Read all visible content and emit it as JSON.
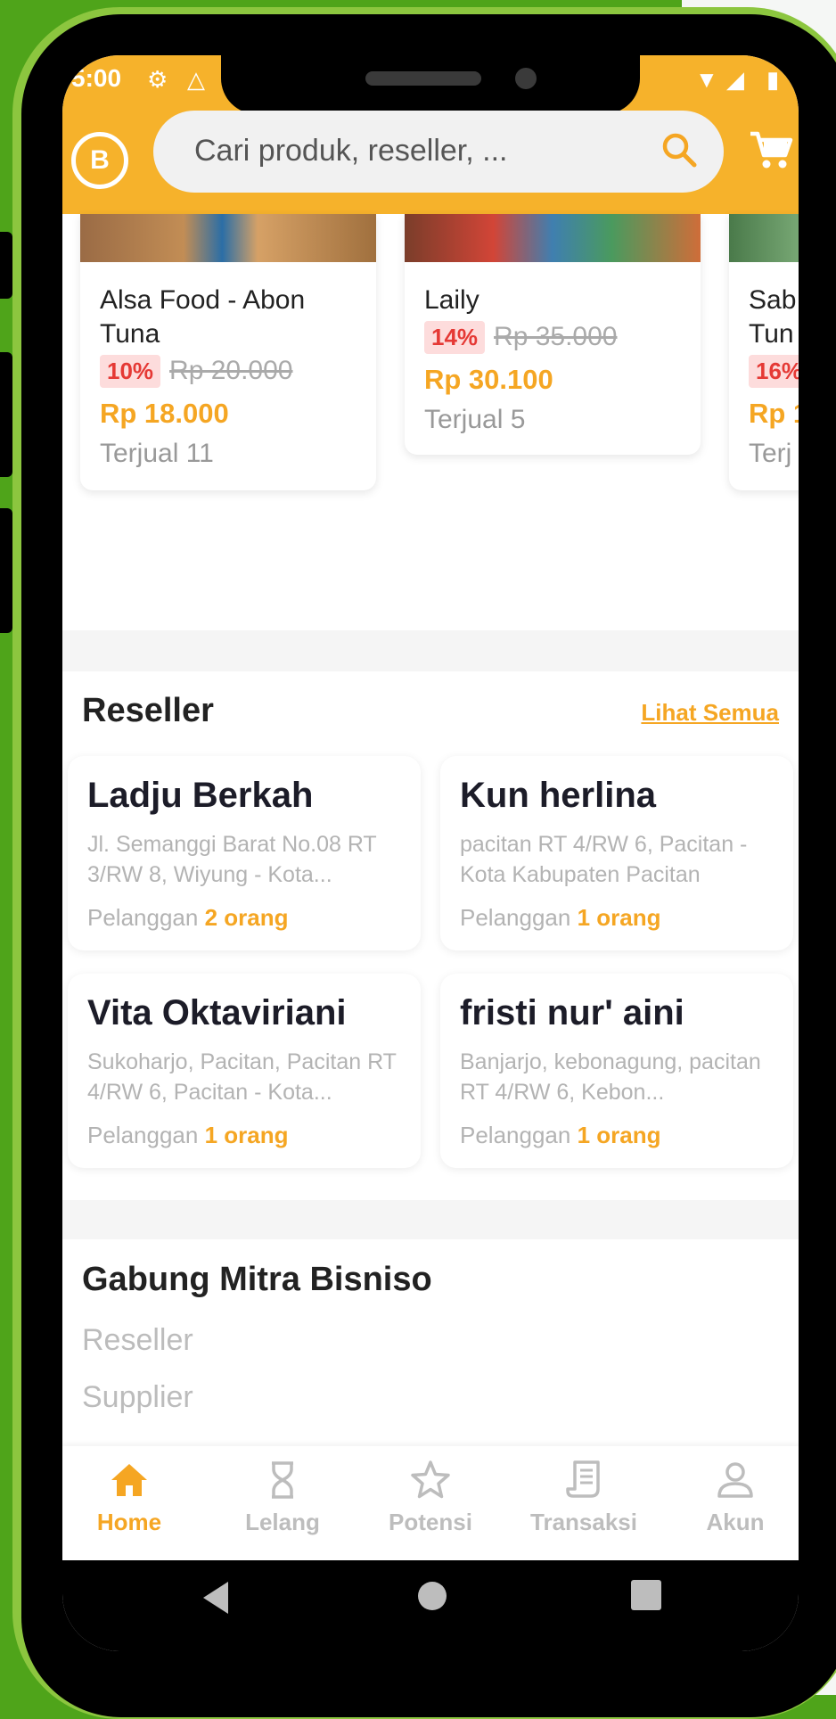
{
  "status": {
    "time": "5:00"
  },
  "header": {
    "logo_letter": "B"
  },
  "search": {
    "placeholder": "Cari produk, reseller, ..."
  },
  "products": [
    {
      "name": "Alsa Food - Abon Tuna",
      "discount": "10%",
      "old_price": "Rp 20.000",
      "price": "Rp 18.000",
      "sold": "Terjual 11"
    },
    {
      "name": "Laily",
      "discount": "14%",
      "old_price": "Rp 35.000",
      "price": "Rp 30.100",
      "sold": "Terjual 5"
    },
    {
      "name": "Sab Tun",
      "discount": "16%",
      "old_price": "",
      "price": "Rp 1",
      "sold": "Terj"
    }
  ],
  "reseller_section": {
    "title": "Reseller",
    "see_all": "Lihat Semua"
  },
  "resellers": [
    {
      "name": "Ladju Berkah",
      "address": "Jl. Semanggi Barat No.08 RT 3/RW 8, Wiyung - Kota...",
      "customer_label": "Pelanggan",
      "customer_count": "2 orang"
    },
    {
      "name": "Kun herlina",
      "address": "pacitan RT 4/RW 6, Pacitan - Kota Kabupaten Pacitan",
      "customer_label": "Pelanggan",
      "customer_count": "1 orang"
    },
    {
      "name": "Vita Oktaviriani",
      "address": "Sukoharjo, Pacitan, Pacitan RT 4/RW 6, Pacitan - Kota...",
      "customer_label": "Pelanggan",
      "customer_count": "1 orang"
    },
    {
      "name": "fristi nur' aini",
      "address": "Banjarjo, kebonagung, pacitan RT 4/RW 6, Kebon...",
      "customer_label": "Pelanggan",
      "customer_count": "1 orang"
    }
  ],
  "join_section": {
    "title": "Gabung Mitra Bisniso",
    "items": [
      "Reseller",
      "Supplier"
    ]
  },
  "nav": {
    "active": "Home",
    "items": [
      {
        "label": "Home",
        "icon": "home-icon"
      },
      {
        "label": "Lelang",
        "icon": "hourglass-icon"
      },
      {
        "label": "Potensi",
        "icon": "star-icon"
      },
      {
        "label": "Transaksi",
        "icon": "receipt-icon"
      },
      {
        "label": "Akun",
        "icon": "user-icon"
      }
    ]
  },
  "colors": {
    "accent": "#f6b22b",
    "price": "#f5a623",
    "discount": "#e53935",
    "frame": "#4fa41a"
  }
}
